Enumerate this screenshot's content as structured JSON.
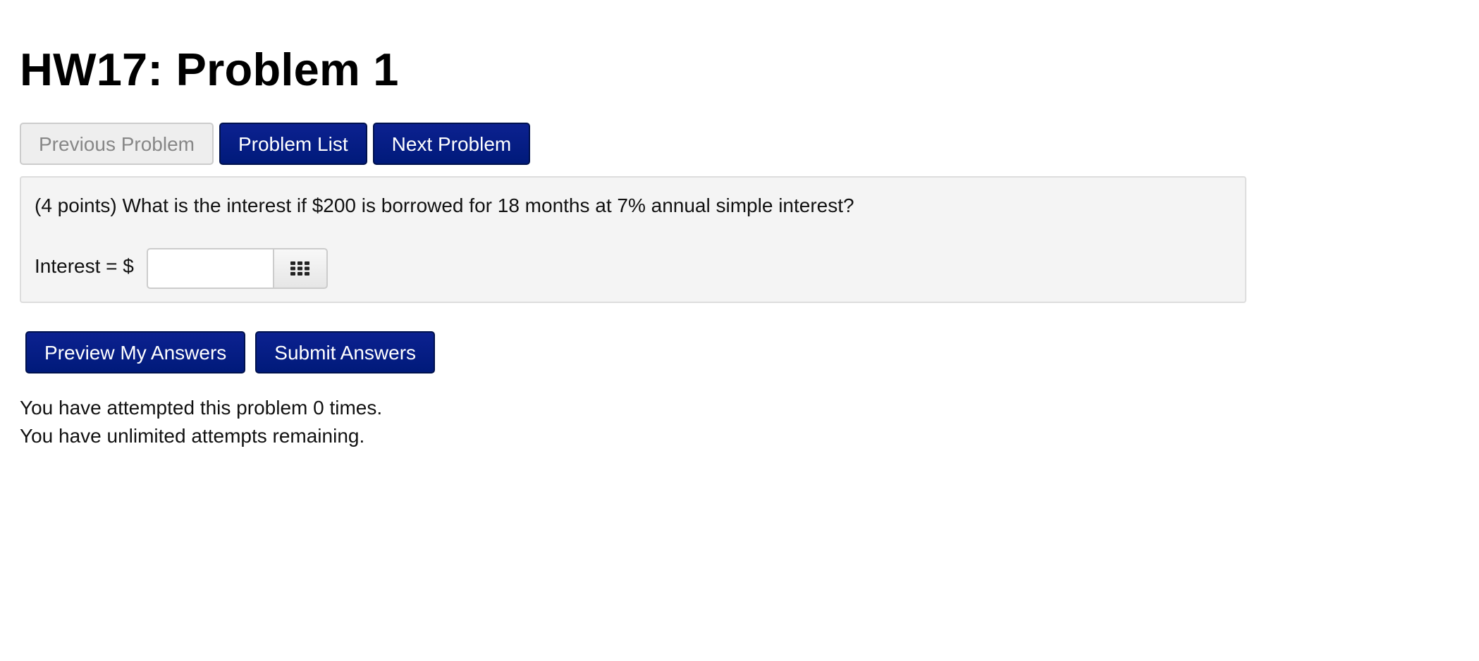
{
  "page": {
    "title": "HW17: Problem 1"
  },
  "nav": {
    "previous_label": "Previous Problem",
    "previous_disabled": true,
    "list_label": "Problem List",
    "next_label": "Next Problem"
  },
  "problem": {
    "text": "(4 points) What is the interest if $200 is borrowed for 18 months at 7% annual simple interest?",
    "answer_label": "Interest = $",
    "answer_value": "",
    "answer_placeholder": "",
    "keypad_icon": "keypad-grid-icon"
  },
  "actions": {
    "preview_label": "Preview My Answers",
    "submit_label": "Submit Answers"
  },
  "attempts": {
    "attempted_text": "You have attempted this problem 0 times.",
    "remaining_text": "You have unlimited attempts remaining."
  },
  "colors": {
    "primary_button": "#001a7a",
    "primary_border": "#00114d",
    "disabled_button": "#eeeeee",
    "disabled_text": "#878787",
    "problem_background": "#f4f4f4",
    "problem_border": "#dddddd"
  }
}
